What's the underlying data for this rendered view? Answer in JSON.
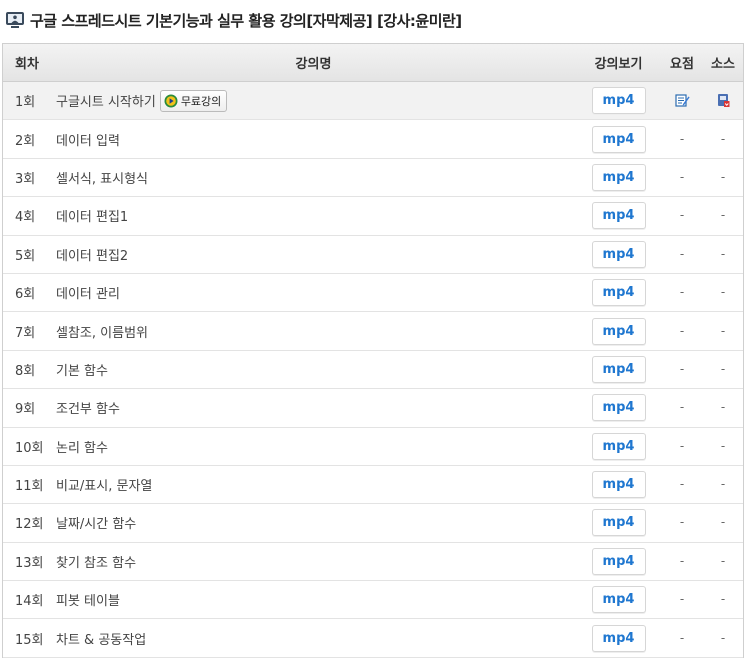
{
  "page": {
    "title": "구글 스프레드시트 기본기능과 실무 활용 강의[자막제공] [강사:윤미란]"
  },
  "table": {
    "headers": {
      "no": "회차",
      "name": "강의명",
      "view": "강의보기",
      "summary": "요점",
      "source": "소스"
    },
    "free_badge_label": "무료강의",
    "rows": [
      {
        "no": "1회",
        "name": "구글시트 시작하기",
        "view": "mp4",
        "summary": "",
        "source": ""
      },
      {
        "no": "2회",
        "name": "데이터 입력",
        "view": "mp4",
        "summary": "-",
        "source": "-"
      },
      {
        "no": "3회",
        "name": "셀서식, 표시형식",
        "view": "mp4",
        "summary": "-",
        "source": "-"
      },
      {
        "no": "4회",
        "name": "데이터 편집1",
        "view": "mp4",
        "summary": "-",
        "source": "-"
      },
      {
        "no": "5회",
        "name": "데이터 편집2",
        "view": "mp4",
        "summary": "-",
        "source": "-"
      },
      {
        "no": "6회",
        "name": "데이터 관리",
        "view": "mp4",
        "summary": "-",
        "source": "-"
      },
      {
        "no": "7회",
        "name": "셀참조, 이름범위",
        "view": "mp4",
        "summary": "-",
        "source": "-"
      },
      {
        "no": "8회",
        "name": "기본 함수",
        "view": "mp4",
        "summary": "-",
        "source": "-"
      },
      {
        "no": "9회",
        "name": "조건부 함수",
        "view": "mp4",
        "summary": "-",
        "source": "-"
      },
      {
        "no": "10회",
        "name": "논리 함수",
        "view": "mp4",
        "summary": "-",
        "source": "-"
      },
      {
        "no": "11회",
        "name": "비교/표시, 문자열",
        "view": "mp4",
        "summary": "-",
        "source": "-"
      },
      {
        "no": "12회",
        "name": "날짜/시간 함수",
        "view": "mp4",
        "summary": "-",
        "source": "-"
      },
      {
        "no": "13회",
        "name": "찾기 참조 함수",
        "view": "mp4",
        "summary": "-",
        "source": "-"
      },
      {
        "no": "14회",
        "name": "피봇 테이블",
        "view": "mp4",
        "summary": "-",
        "source": "-"
      },
      {
        "no": "15회",
        "name": "차트 & 공동작업",
        "view": "mp4",
        "summary": "-",
        "source": "-"
      }
    ]
  },
  "icons": {
    "title": "monitor-user-icon",
    "free": "play-circle-icon",
    "summary": "edit-note-icon",
    "source": "download-file-icon"
  },
  "colors": {
    "mp4_text": "#1f77d0",
    "header_bg": "#e8e8e8",
    "first_row_bg": "#f2f2f2"
  }
}
